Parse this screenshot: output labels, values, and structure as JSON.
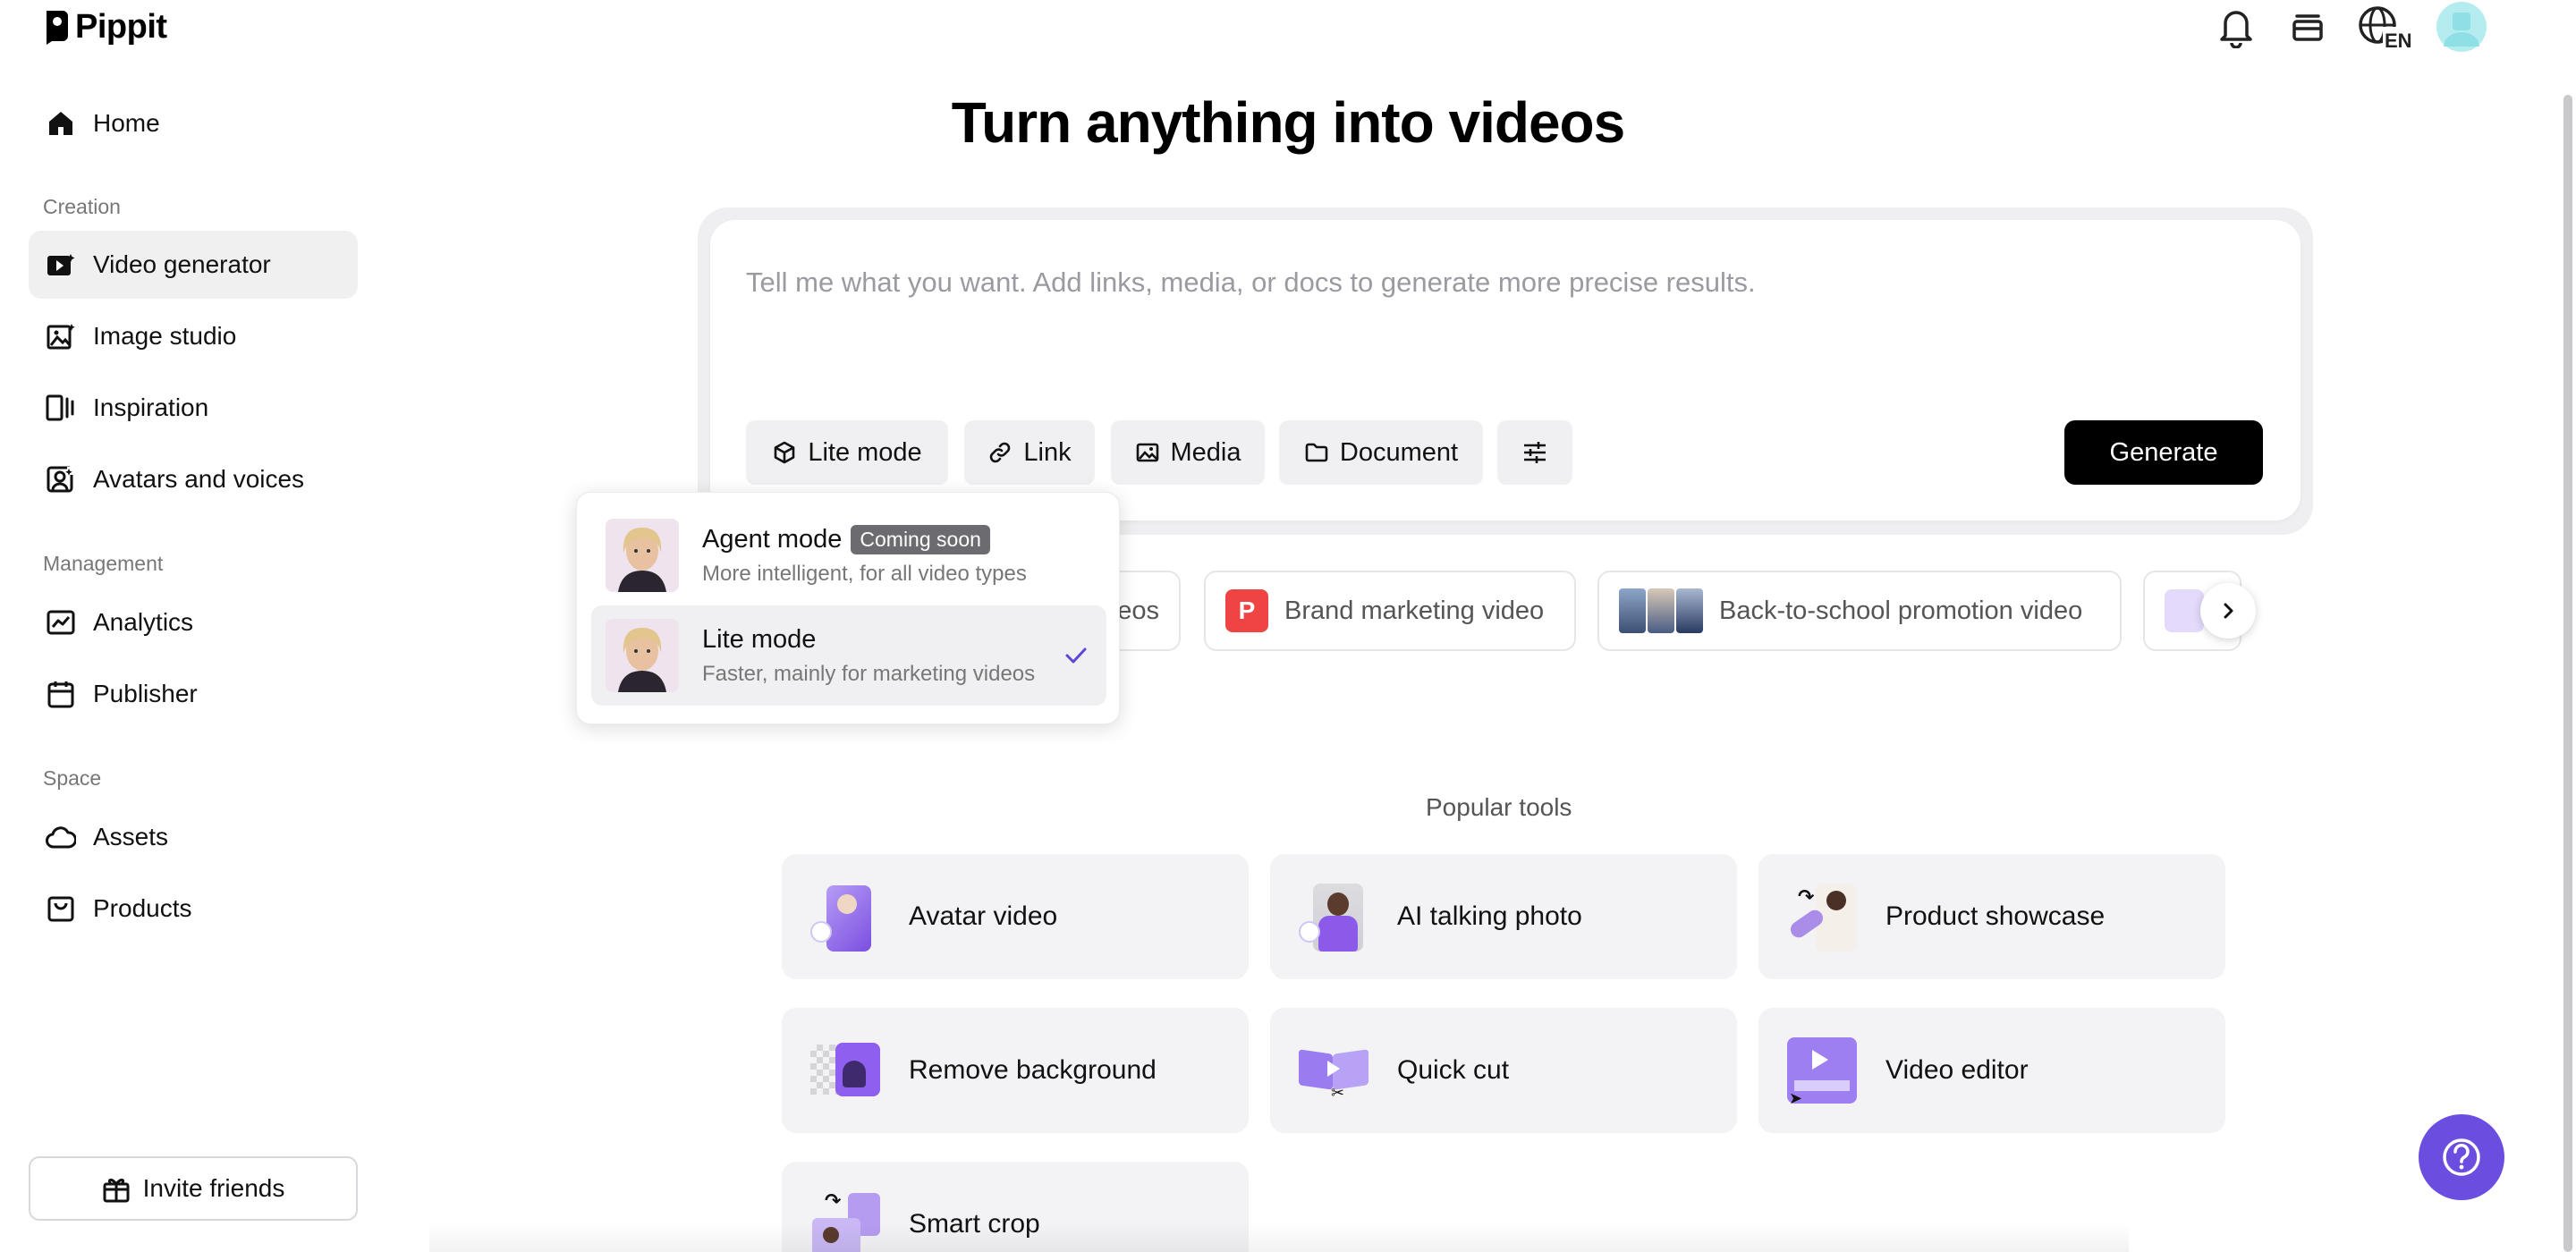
{
  "app": {
    "name": "Pippit"
  },
  "header": {
    "language": "EN"
  },
  "sidebar": {
    "home": "Home",
    "sections": [
      {
        "title": "Creation",
        "items": [
          "Video generator",
          "Image studio",
          "Inspiration",
          "Avatars and voices"
        ]
      },
      {
        "title": "Management",
        "items": [
          "Analytics",
          "Publisher"
        ]
      },
      {
        "title": "Space",
        "items": [
          "Assets",
          "Products"
        ]
      }
    ],
    "active_item": "Video generator",
    "invite": "Invite friends"
  },
  "main": {
    "title": "Turn anything into videos",
    "prompt_placeholder": "Tell me what you want. Add links, media, or docs to generate more precise results.",
    "chips": {
      "mode": "Lite mode",
      "link": "Link",
      "media": "Media",
      "document": "Document"
    },
    "generate": "Generate",
    "suggestions": [
      "eos",
      "Brand marketing video",
      "Back-to-school promotion video"
    ],
    "brand_letter": "P",
    "popular_title": "Popular tools",
    "tools": [
      "Avatar video",
      "AI talking photo",
      "Product showcase",
      "Remove background",
      "Quick cut",
      "Video editor",
      "Smart crop"
    ]
  },
  "dropdown": {
    "agent": {
      "title": "Agent mode",
      "badge": "Coming soon",
      "subtitle": "More intelligent, for all video types"
    },
    "lite": {
      "title": "Lite mode",
      "subtitle": "Faster, mainly for marketing videos",
      "selected": true
    }
  },
  "colors": {
    "accent": "#6b4ee0",
    "brand_red": "#ef4444",
    "active_bg": "#f0f0f1"
  }
}
